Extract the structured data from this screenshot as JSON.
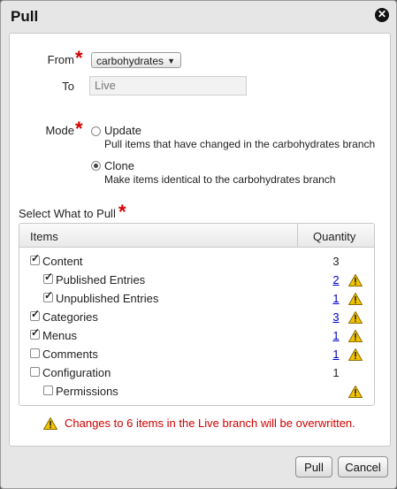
{
  "dialog": {
    "title": "Pull",
    "close_icon": "close-circle-icon"
  },
  "form": {
    "from_label": "From",
    "from_value": "carbohydrates",
    "to_label": "To",
    "to_value": "Live",
    "mode_label": "Mode",
    "required_mark": "*",
    "modes": [
      {
        "label": "Update",
        "description": "Pull items that have changed in the carbohydrates branch",
        "selected": false
      },
      {
        "label": "Clone",
        "description": "Make items identical to the carbohydrates branch",
        "selected": true
      }
    ],
    "select_label": "Select What to Pull"
  },
  "table": {
    "col_items": "Items",
    "col_quantity": "Quantity",
    "rows": [
      {
        "label": "Content",
        "checked": true,
        "quantity": "3",
        "link": false,
        "warning": false
      },
      {
        "label": "Published Entries",
        "checked": true,
        "quantity": "2",
        "link": true,
        "warning": true
      },
      {
        "label": "Unpublished Entries",
        "checked": true,
        "quantity": "1",
        "link": true,
        "warning": true
      },
      {
        "label": "Categories",
        "checked": true,
        "quantity": "3",
        "link": true,
        "warning": true
      },
      {
        "label": "Menus",
        "checked": true,
        "quantity": "1",
        "link": true,
        "warning": true
      },
      {
        "label": "Comments",
        "checked": false,
        "quantity": "1",
        "link": true,
        "warning": true
      },
      {
        "label": "Configuration",
        "checked": false,
        "quantity": "1",
        "link": false,
        "warning": false
      },
      {
        "label": "Permissions",
        "checked": false,
        "quantity": "",
        "link": false,
        "warning": true
      }
    ]
  },
  "notice": {
    "text": "Changes to 6 items in the Live branch will be overwritten.",
    "icon": "warning-icon",
    "color": "#d00000"
  },
  "buttons": {
    "pull": "Pull",
    "cancel": "Cancel"
  },
  "colors": {
    "required": "#d40000",
    "link": "#0000cc",
    "warning": "#f2c200"
  }
}
